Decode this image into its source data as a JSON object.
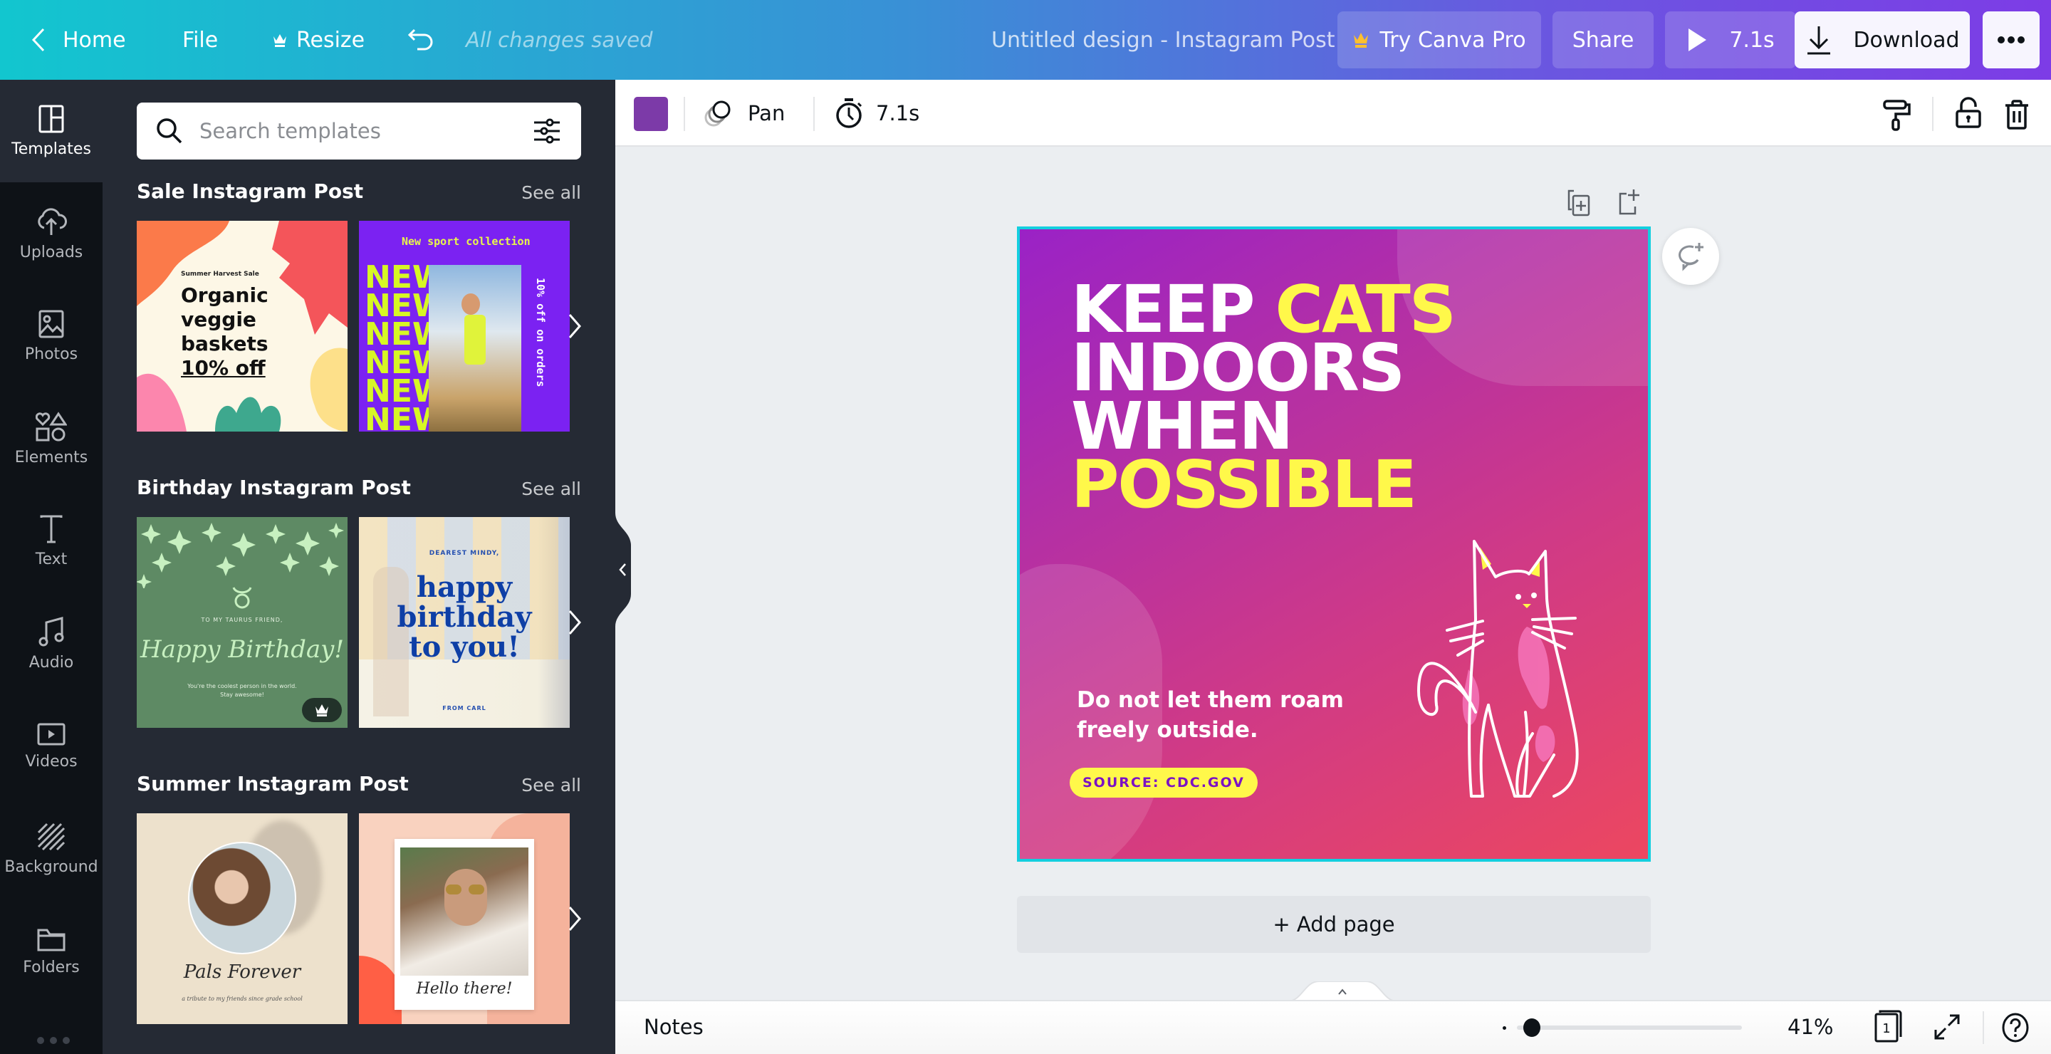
{
  "topbar": {
    "home_label": "Home",
    "file_label": "File",
    "resize_label": "Resize",
    "save_status": "All changes saved",
    "document_title": "Untitled design - Instagram Post",
    "try_pro_label": "Try Canva Pro",
    "share_label": "Share",
    "play_duration": "7.1s",
    "download_label": "Download",
    "gradient_colors": [
      "#12c6cf",
      "#7d3ce6"
    ],
    "pro_crown_color": "#ffc02e"
  },
  "rail": {
    "items": [
      {
        "label": "Templates",
        "icon": "templates-icon",
        "active": true
      },
      {
        "label": "Uploads",
        "icon": "upload-cloud-icon"
      },
      {
        "label": "Photos",
        "icon": "photo-icon"
      },
      {
        "label": "Elements",
        "icon": "shapes-icon"
      },
      {
        "label": "Text",
        "icon": "text-icon"
      },
      {
        "label": "Audio",
        "icon": "music-note-icon"
      },
      {
        "label": "Videos",
        "icon": "video-icon"
      },
      {
        "label": "Background",
        "icon": "background-stripes-icon"
      },
      {
        "label": "Folders",
        "icon": "folder-icon"
      }
    ]
  },
  "panel": {
    "search_placeholder": "Search templates",
    "sections": [
      {
        "title": "Sale Instagram Post",
        "see_all": "See all",
        "templates": [
          {
            "small": "Summer Harvest Sale",
            "lines": [
              "Organic",
              "veggie",
              "baskets",
              "10% off"
            ]
          },
          {
            "top": "New sport collection",
            "big": "NEW",
            "side": "10% off on orders"
          }
        ]
      },
      {
        "title": "Birthday Instagram Post",
        "see_all": "See all",
        "templates": [
          {
            "top": "TO MY TAURUS FRIEND,",
            "script": "Happy Birthday!",
            "sub": [
              "You're the coolest person in the world.",
              "Stay awesome!"
            ],
            "pro": true
          },
          {
            "top": "DEAREST MINDY,",
            "lines": [
              "happy",
              "birthday",
              "to you!"
            ],
            "bottom": "FROM CARL"
          }
        ]
      },
      {
        "title": "Summer Instagram Post",
        "see_all": "See all",
        "templates": [
          {
            "script": "Pals Forever",
            "sub": "a tribute to my friends since grade school"
          },
          {
            "script": "Hello there!"
          }
        ]
      }
    ]
  },
  "toolbar": {
    "color_swatch": "#7c3aa8",
    "animation_label": "Pan",
    "timing_label": "7.1s"
  },
  "design": {
    "headline_lines": [
      [
        {
          "text": "KEEP ",
          "highlight": false
        },
        {
          "text": "CATS",
          "highlight": true
        }
      ],
      [
        {
          "text": "INDOORS",
          "highlight": false
        }
      ],
      [
        {
          "text": "WHEN",
          "highlight": false
        }
      ],
      [
        {
          "text": "POSSIBLE",
          "highlight": true
        }
      ]
    ],
    "subtext_line1": "Do not let them roam",
    "subtext_line2": "freely outside.",
    "source_label": "SOURCE: CDC.GOV",
    "highlight_color": "#fff84a",
    "selection_color": "#13cfdf"
  },
  "canvas": {
    "add_page_label": "+ Add page"
  },
  "bottombar": {
    "notes_label": "Notes",
    "zoom_percent": "41%",
    "zoom_fraction": 0.03,
    "page_count": "1"
  }
}
